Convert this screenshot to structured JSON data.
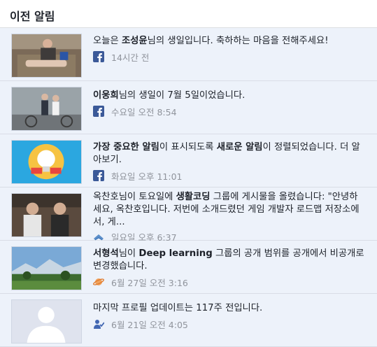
{
  "header": {
    "title": "이전 알림"
  },
  "notifications": [
    {
      "parts": [
        "오늘은 ",
        "조성윤",
        "님의 생일입니다. 축하하는 마음을 전해주세요!"
      ],
      "time": "14시간 전",
      "icon": "facebook-icon"
    },
    {
      "parts": [
        "",
        "이웅희",
        "님의 생일이 7월 5일이었습니다."
      ],
      "time": "수요일 오전 8:54",
      "icon": "facebook-icon"
    },
    {
      "parts": [
        "",
        "가장 중요한 알림",
        "이 표시되도록 ",
        "새로운 알림",
        "이 정렬되었습니다. 더 알아보기."
      ],
      "time": "화요일 오후 11:01",
      "icon": "facebook-icon"
    },
    {
      "parts": [
        "옥찬호님이 토요일에 ",
        "생활코딩",
        " 그룹에 게시물을 올렸습니다: \"안녕하세요, 옥찬호입니다. 저번에 소개드렸던 게임 개발자 로드맵 저장소에서, 게..."
      ],
      "time": "일요일 오후 6:37",
      "icon": "group-icon"
    },
    {
      "parts": [
        "",
        "서형석",
        "님이 ",
        "Deep learning",
        " 그룹의 공개 범위를 공개에서 비공개로 변경했습니다."
      ],
      "time": "6월 27일 오전 3:16",
      "icon": "planet-icon"
    },
    {
      "parts": [
        "마지막 프로필 업데이트는 117주 전입니다."
      ],
      "time": "6월 21일 오전 4:05",
      "icon": "profile-update-icon"
    }
  ],
  "colors": {
    "item_bg": "#edf2fa",
    "facebook_blue": "#3b5998",
    "meta_gray": "#90949c"
  }
}
